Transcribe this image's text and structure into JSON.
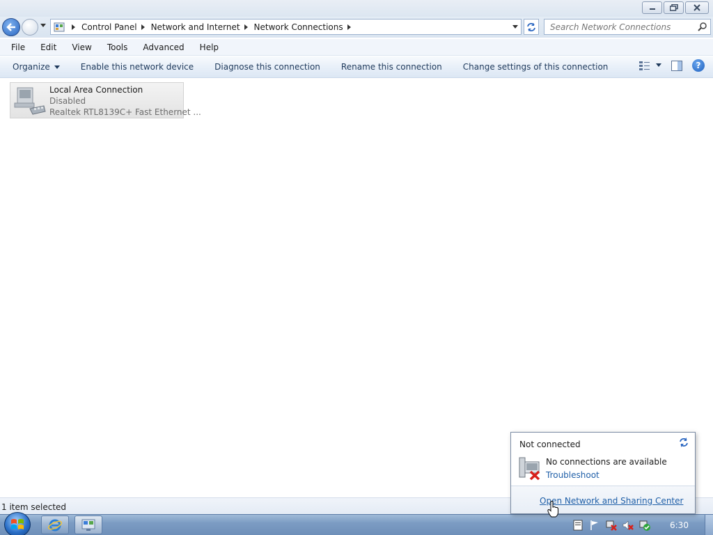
{
  "address": {
    "breadcrumbs": [
      "Control Panel",
      "Network and Internet",
      "Network Connections"
    ]
  },
  "search": {
    "placeholder": "Search Network Connections"
  },
  "menu": {
    "items": [
      "File",
      "Edit",
      "View",
      "Tools",
      "Advanced",
      "Help"
    ]
  },
  "commands": {
    "organize": "Organize",
    "enable": "Enable this network device",
    "diagnose": "Diagnose this connection",
    "rename": "Rename this connection",
    "change": "Change settings of this connection"
  },
  "connection": {
    "name": "Local Area Connection",
    "status": "Disabled",
    "device": "Realtek RTL8139C+ Fast Ethernet ..."
  },
  "statusbar": {
    "text": "1 item selected"
  },
  "popup": {
    "title": "Not connected",
    "message": "No connections are available",
    "troubleshoot": "Troubleshoot",
    "link": "Open Network and Sharing Center"
  },
  "taskbar": {
    "clock": "6:30"
  },
  "icons": {
    "back": "back-arrow-icon",
    "forward": "forward-arrow-icon",
    "refresh": "refresh-icon",
    "search": "search-icon",
    "help": "help-icon",
    "network_adapter": "network-adapter-icon",
    "network_error": "network-disconnected-icon"
  },
  "colors": {
    "link": "#1f5fa8",
    "accent": "#1e395b"
  }
}
